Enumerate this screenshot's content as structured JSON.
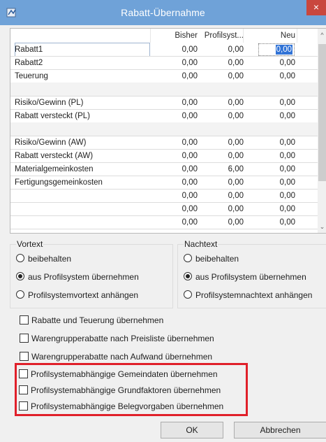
{
  "window": {
    "title": "Rabatt-Übernahme",
    "close_glyph": "×",
    "icon": "app-icon"
  },
  "grid": {
    "columns": [
      "",
      "Bisher",
      "Profilsyst...",
      "Neu"
    ],
    "rows": [
      [
        "Rabatt1",
        "0,00",
        "0,00",
        "0,00"
      ],
      [
        "Rabatt2",
        "0,00",
        "0,00",
        "0,00"
      ],
      [
        "Teuerung",
        "0,00",
        "0,00",
        "0,00"
      ],
      [
        "",
        "",
        "",
        ""
      ],
      [
        "Risiko/Gewinn (PL)",
        "0,00",
        "0,00",
        "0,00"
      ],
      [
        "Rabatt versteckt (PL)",
        "0,00",
        "0,00",
        "0,00"
      ],
      [
        "",
        "",
        "",
        ""
      ],
      [
        "Risiko/Gewinn (AW)",
        "0,00",
        "0,00",
        "0,00"
      ],
      [
        "Rabatt versteckt (AW)",
        "0,00",
        "0,00",
        "0,00"
      ],
      [
        "Materialgemeinkosten",
        "0,00",
        "6,00",
        "0,00"
      ],
      [
        "Fertigungsgemeinkosten",
        "0,00",
        "0,00",
        "0,00"
      ],
      [
        "",
        "0,00",
        "0,00",
        "0,00"
      ],
      [
        "",
        "0,00",
        "0,00",
        "0,00"
      ],
      [
        "",
        "0,00",
        "0,00",
        "0,00"
      ]
    ],
    "scroll_up": "^",
    "scroll_down": "⌄"
  },
  "vortext": {
    "title": "Vortext",
    "options": [
      "beibehalten",
      "aus Profilsystem übernehmen",
      "Profilsystemvortext anhängen"
    ],
    "selected": 1
  },
  "nachtext": {
    "title": "Nachtext",
    "options": [
      "beibehalten",
      "aus Profilsystem übernehmen",
      "Profilsystemnachtext anhängen"
    ],
    "selected": 1
  },
  "checkboxes": [
    {
      "label": "Rabatte und Teuerung übernehmen",
      "checked": false
    },
    {
      "label": "Warengrupperabatte nach Preisliste übernehmen",
      "checked": false
    },
    {
      "label": "Warengrupperabatte nach Aufwand übernehmen",
      "checked": false
    },
    {
      "label": "Profilsystemabhängige Gemeindaten übernehmen",
      "checked": false
    },
    {
      "label": "Profilsystemabhängige Grundfaktoren übernehmen",
      "checked": false
    },
    {
      "label": "Profilsystemabhängige Belegvorgaben übernehmen",
      "checked": false
    }
  ],
  "buttons": {
    "ok": "OK",
    "cancel": "Abbrechen"
  },
  "colors": {
    "titlebar": "#6fa2d8",
    "close": "#c9473e",
    "highlight": "#e0202a",
    "selection": "#3173d6"
  }
}
